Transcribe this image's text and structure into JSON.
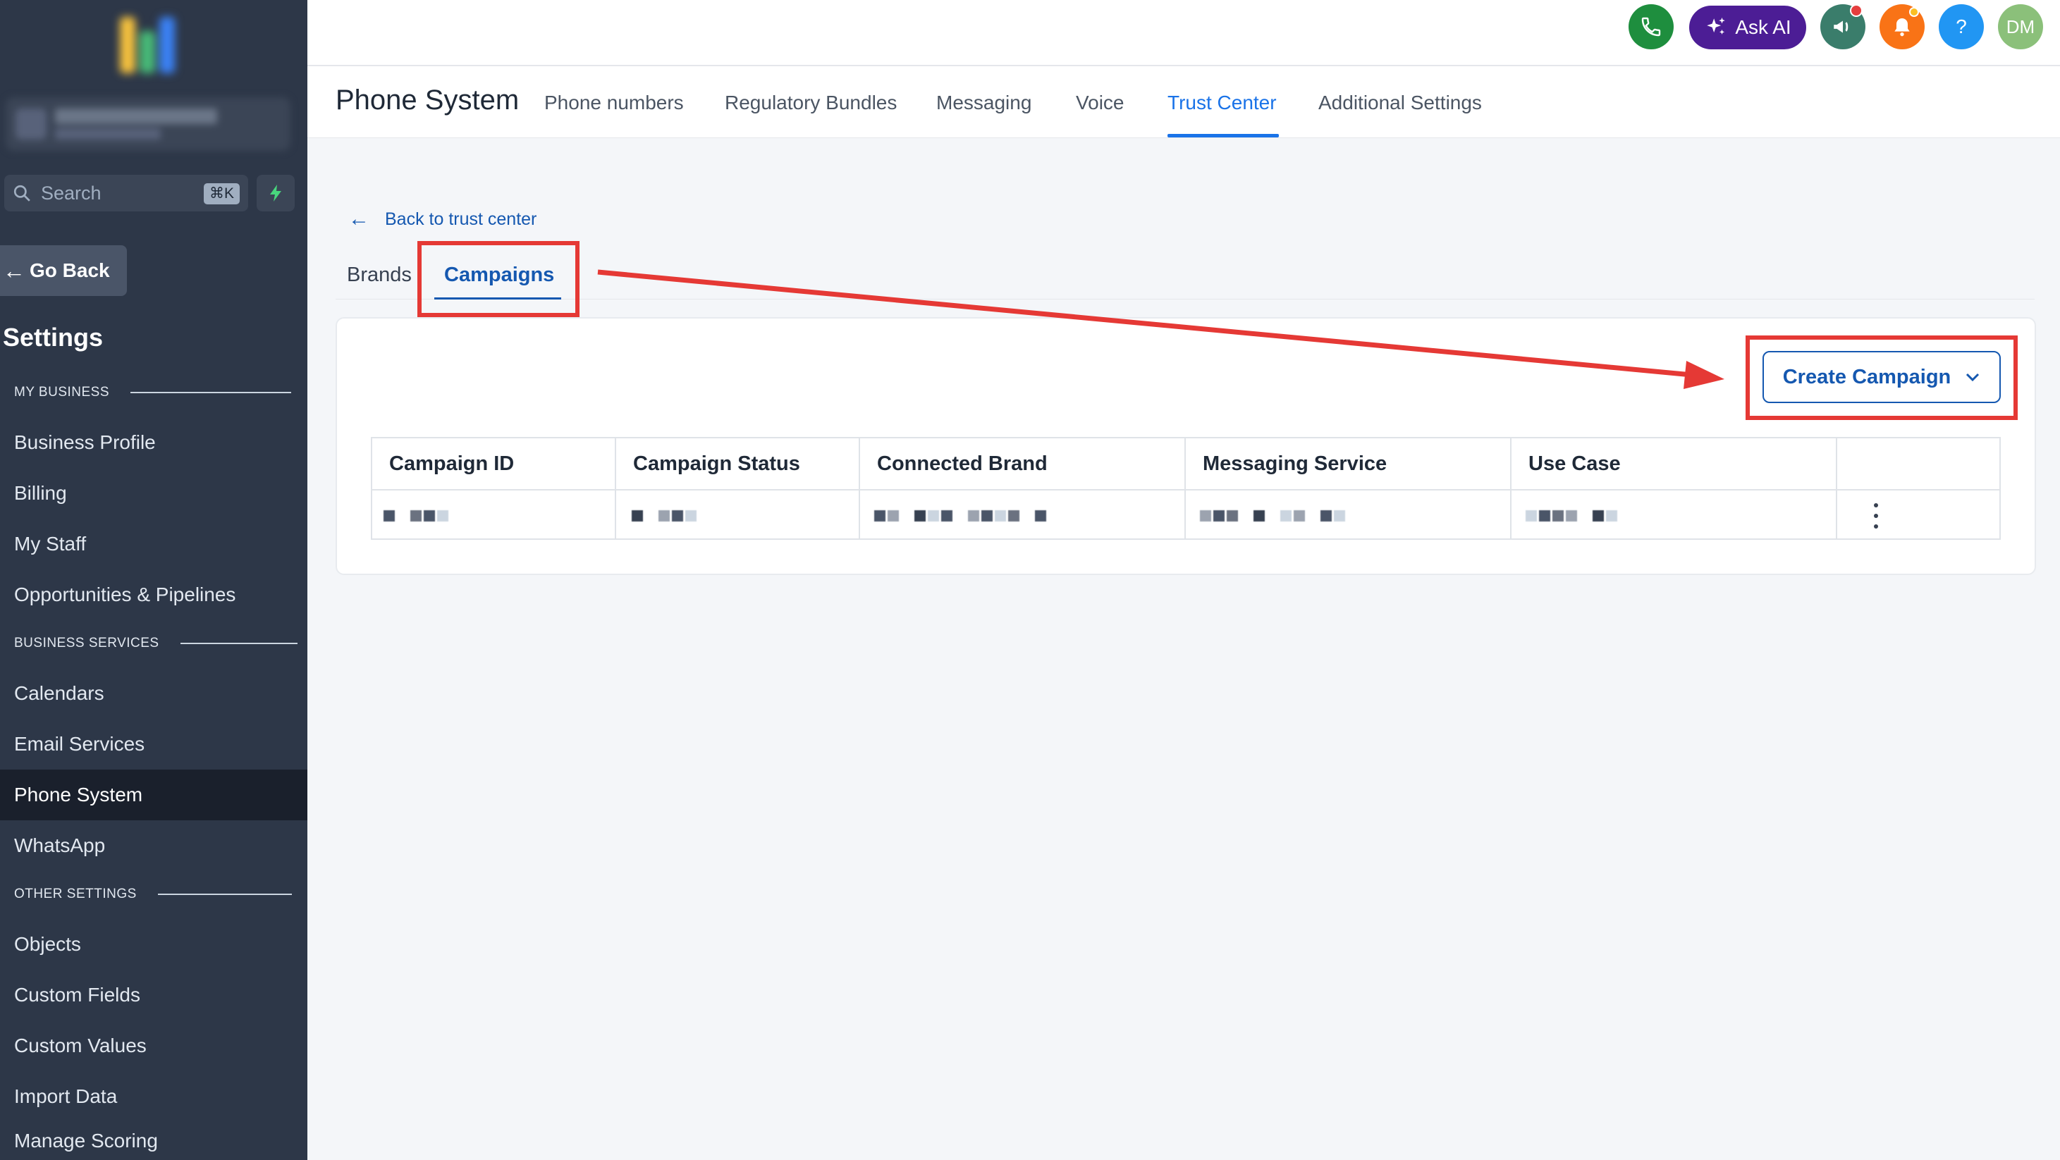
{
  "sidebar": {
    "search": {
      "placeholder": "Search",
      "shortcut": "⌘K"
    },
    "go_back": "Go Back",
    "title": "Settings",
    "sections": [
      {
        "label": "MY BUSINESS",
        "items": [
          "Business Profile",
          "Billing",
          "My Staff",
          "Opportunities & Pipelines"
        ]
      },
      {
        "label": "BUSINESS SERVICES",
        "items": [
          "Calendars",
          "Email Services",
          "Phone System",
          "WhatsApp"
        ]
      },
      {
        "label": "OTHER SETTINGS",
        "items": [
          "Objects",
          "Custom Fields",
          "Custom Values",
          "Import Data",
          "Manage Scoring"
        ]
      }
    ],
    "active_item": "Phone System"
  },
  "topbar": {
    "ask_ai": "Ask AI",
    "avatar_initials": "DM",
    "help": "?",
    "colors": {
      "phone": "#1e8e3e",
      "ask_ai": "#4c1d95",
      "megaphone": "#3a7d6b",
      "bell": "#f97316",
      "help": "#2196f3",
      "avatar": "#8bc07a"
    }
  },
  "header": {
    "title": "Phone System",
    "tabs": [
      "Phone numbers",
      "Regulatory Bundles",
      "Messaging",
      "Voice",
      "Trust Center",
      "Additional Settings"
    ],
    "active_tab": "Trust Center"
  },
  "content": {
    "back_link": "Back to trust center",
    "subtabs": [
      "Brands",
      "Campaigns"
    ],
    "active_subtab": "Campaigns",
    "create_button": "Create Campaign",
    "table": {
      "columns": [
        "Campaign ID",
        "Campaign Status",
        "Connected Brand",
        "Messaging Service",
        "Use Case"
      ]
    }
  },
  "colors": {
    "accent": "#1558b0",
    "sidebar_bg": "#2d3748",
    "annotation": "#e53935"
  }
}
